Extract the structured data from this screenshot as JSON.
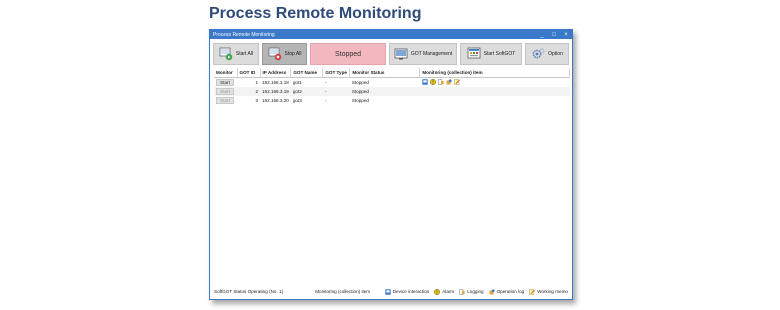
{
  "page_heading": "Process Remote Monitoring",
  "window": {
    "title": "Process Remote Monitoring",
    "controls": {
      "minimize": "_",
      "maximize": "□",
      "close": "×"
    }
  },
  "toolbar": {
    "start_all": "Start All",
    "stop_all": "Stop All",
    "status": "Stopped",
    "got_management": "GOT Management",
    "start_softgot": "Start SoftGOT",
    "option": "Option"
  },
  "colors": {
    "title_bar": "#3a78c9",
    "heading": "#2e4a78",
    "status_stopped": "#f2b8c0"
  },
  "table": {
    "headers": [
      "Monitor",
      "GOT ID",
      "IP Address",
      "GOT Name",
      "GOT Type",
      "Monitor Status",
      "Monitoring (collection) item"
    ],
    "rows": [
      {
        "monitor": "Start",
        "got_id": "1",
        "ip": "192.168.3.18",
        "name": "got1",
        "type": "-",
        "status": "Stopped",
        "items": [
          "device-interaction-icon",
          "alarm-icon",
          "logging-icon",
          "operation-log-icon",
          "working-memo-icon"
        ]
      },
      {
        "monitor": "Start",
        "got_id": "2",
        "ip": "192.168.3.19",
        "name": "got2",
        "type": "-",
        "status": "Stopped",
        "items": []
      },
      {
        "monitor": "Start",
        "got_id": "3",
        "ip": "192.168.3.20",
        "name": "got3",
        "type": "-",
        "status": "Stopped",
        "items": []
      }
    ]
  },
  "statusbar": {
    "softgot_status": "SoftGOT Status Operating (No. 1)",
    "monitoring_item_label": "Monitoring (collection) item",
    "legend": {
      "device_interaction": "Device interaction",
      "alarm": "Alarm",
      "logging": "Logging",
      "operation_log": "Operation log",
      "working_memo": "Working memo"
    }
  }
}
